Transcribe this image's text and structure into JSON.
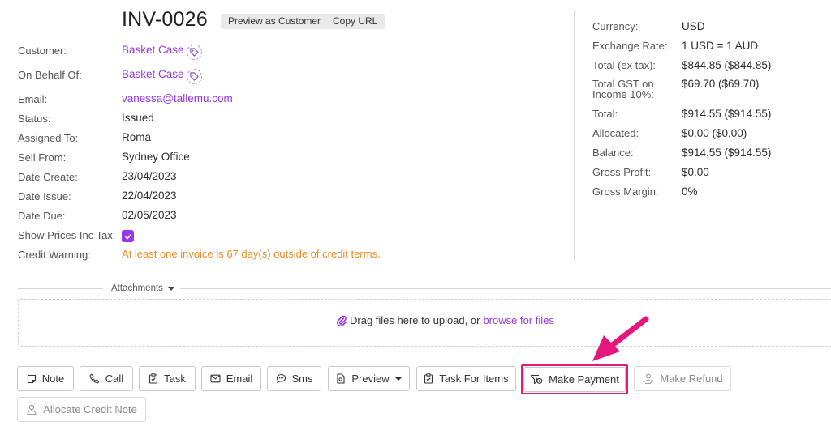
{
  "header": {
    "invoice_number": "INV-0026",
    "preview_button": "Preview as Customer",
    "copy_url_button": "Copy URL"
  },
  "details": {
    "customer": {
      "label": "Customer:",
      "value": "Basket Case"
    },
    "on_behalf_of": {
      "label": "On Behalf Of:",
      "value": "Basket Case"
    },
    "email": {
      "label": "Email:",
      "value": "vanessa@tallemu.com"
    },
    "status": {
      "label": "Status:",
      "value": "Issued"
    },
    "assigned_to": {
      "label": "Assigned To:",
      "value": "Roma"
    },
    "sell_from": {
      "label": "Sell From:",
      "value": "Sydney Office"
    },
    "date_create": {
      "label": "Date Create:",
      "value": "23/04/2023"
    },
    "date_issue": {
      "label": "Date Issue:",
      "value": "22/04/2023"
    },
    "date_due": {
      "label": "Date Due:",
      "value": "02/05/2023"
    },
    "show_prices_inc_tax": {
      "label": "Show Prices Inc Tax:",
      "checked": true
    },
    "credit_warning": {
      "label": "Credit Warning:",
      "value": "At least one invoice is 67 day(s) outside of credit terms."
    }
  },
  "summary": {
    "currency": {
      "label": "Currency:",
      "value": "USD"
    },
    "exchange_rate": {
      "label": "Exchange Rate:",
      "value": "1 USD = 1 AUD"
    },
    "total_ex_tax": {
      "label": "Total (ex tax):",
      "value": "$844.85 ($844.85)"
    },
    "gst": {
      "label_line1": "Total GST on",
      "label_line2": "Income 10%:",
      "value": "$69.70 ($69.70)"
    },
    "total": {
      "label": "Total:",
      "value": "$914.55 ($914.55)"
    },
    "allocated": {
      "label": "Allocated:",
      "value": "$0.00 ($0.00)"
    },
    "balance": {
      "label": "Balance:",
      "value": "$914.55 ($914.55)"
    },
    "gross_profit": {
      "label": "Gross Profit:",
      "value": "$0.00"
    },
    "gross_margin": {
      "label": "Gross Margin:",
      "value": "0%"
    }
  },
  "attachments": {
    "label": "Attachments",
    "drop_text": "Drag files here to upload, or",
    "browse_link": "browse for files"
  },
  "actions": {
    "note": "Note",
    "call": "Call",
    "task": "Task",
    "email": "Email",
    "sms": "Sms",
    "preview": "Preview",
    "task_for_items": "Task For Items",
    "make_payment": "Make Payment",
    "make_refund": "Make Refund",
    "allocate_credit_note": "Allocate Credit Note"
  },
  "colors": {
    "accent": "#9b35e6",
    "warning": "#f08a24",
    "highlight": "#e6167f"
  }
}
